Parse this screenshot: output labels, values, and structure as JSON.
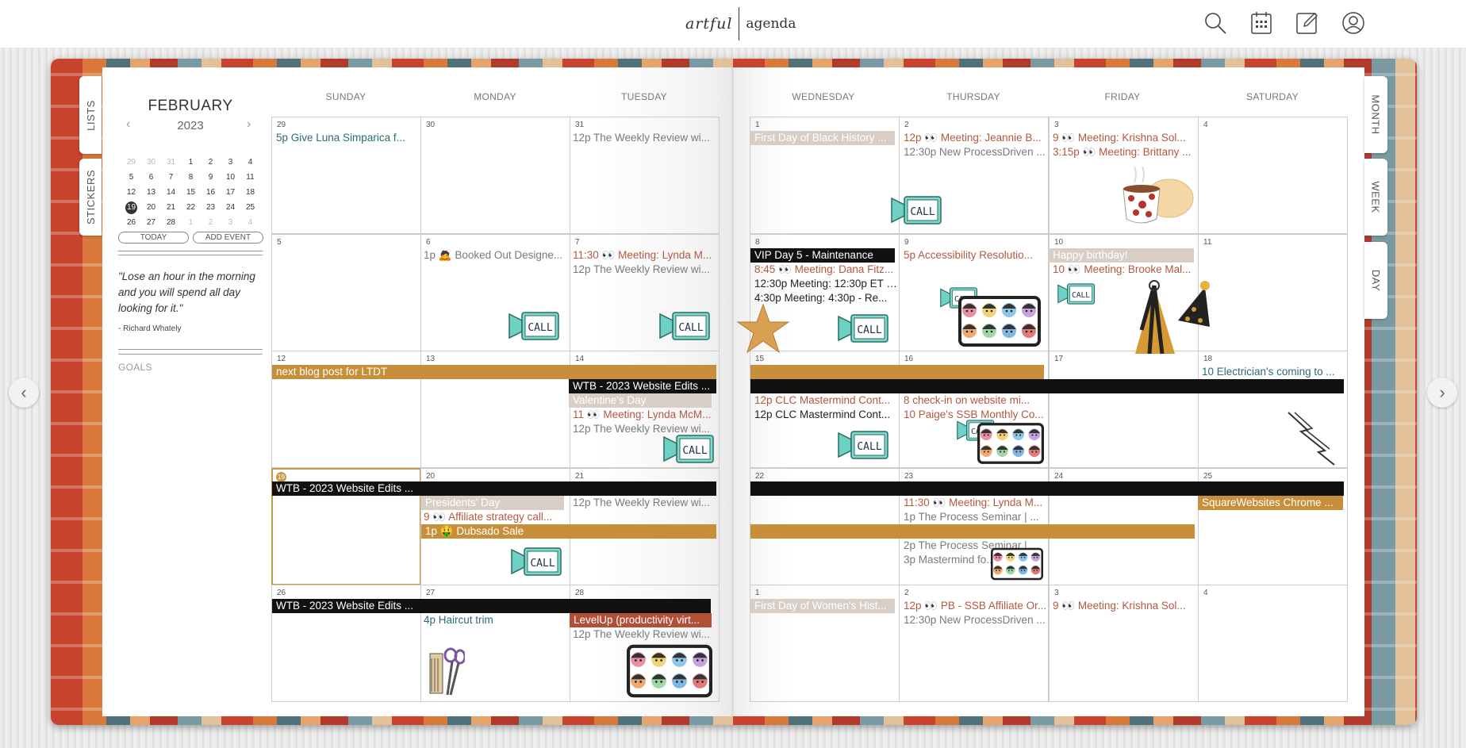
{
  "header": {
    "logo_left": "artful",
    "logo_right": "agenda",
    "icons": [
      "search-icon",
      "calendar-icon",
      "edit-icon",
      "user-icon"
    ]
  },
  "tabs": {
    "left": [
      "LISTS",
      "STICKERS"
    ],
    "right": [
      "MONTH",
      "WEEK",
      "DAY"
    ]
  },
  "sidebar": {
    "month": "FEBRUARY",
    "year": "2023",
    "prev_icon": "‹",
    "next_icon": "›",
    "mini_days": [
      [
        "29",
        "30",
        "31",
        "1",
        "2",
        "3",
        "4"
      ],
      [
        "5",
        "6",
        "7",
        "8",
        "9",
        "10",
        "11"
      ],
      [
        "12",
        "13",
        "14",
        "15",
        "16",
        "17",
        "18"
      ],
      [
        "19",
        "20",
        "21",
        "22",
        "23",
        "24",
        "25"
      ],
      [
        "26",
        "27",
        "28",
        "1",
        "2",
        "3",
        "4"
      ]
    ],
    "today_button": "TODAY",
    "add_event_button": "ADD EVENT",
    "quote": "\"Lose an hour in the morning and you will spend all day looking for it.\"",
    "author": "- Richard Whately",
    "goals": "GOALS"
  },
  "weekdays": [
    "SUNDAY",
    "MONDAY",
    "TUESDAY",
    "WEDNESDAY",
    "THURSDAY",
    "FRIDAY",
    "SATURDAY"
  ],
  "days": [
    [
      "29",
      "30",
      "31",
      "1",
      "2",
      "3",
      "4"
    ],
    [
      "5",
      "6",
      "7",
      "8",
      "9",
      "10",
      "11"
    ],
    [
      "12",
      "13",
      "14",
      "15",
      "16",
      "17",
      "18"
    ],
    [
      "19",
      "20",
      "21",
      "22",
      "23",
      "24",
      "25"
    ],
    [
      "26",
      "27",
      "28",
      "1",
      "2",
      "3",
      "4"
    ]
  ],
  "events": {
    "w1": {
      "sun": "5p Give Luna Simparica f...",
      "tue": "12p The Weekly Review wi...",
      "wed": "First Day of Black History ...",
      "thu1": "12p 👀 Meeting: Jeannie B...",
      "thu2": "12:30p New ProcessDriven ...",
      "fri1": "9 👀 Meeting: Krishna Sol...",
      "fri2": "3:15p 👀 Meeting: Brittany ..."
    },
    "w2": {
      "mon": "1p 🙇 Booked Out Designe...",
      "tue1": "11:30 👀 Meeting: Lynda M...",
      "tue2": "12p The Weekly Review wi...",
      "wed_bar": "VIP Day 5 - Maintenance",
      "wed1": "8:45 👀 Meeting: Dana Fitz...",
      "wed2": "12:30p Meeting: 12:30p ET -...",
      "wed3": "4:30p Meeting: 4:30p - Re...",
      "thu": "5p Accessibility Resolutio...",
      "fri_bar": "Happy birthday!",
      "fri": "10 👀 Meeting: Brooke Mal..."
    },
    "w3": {
      "blog_bar": "next blog post for LTDT",
      "wtb_bar": "WTB - 2023 Website Edits ...",
      "valentine": "Valentine's Day",
      "tue1": "11 👀 Meeting: Lynda McM...",
      "tue2": "12p The Weekly Review wi...",
      "wed1": "12p CLC Mastermind Cont...",
      "wed2": "12p CLC Mastermind Cont...",
      "thu1": "8 check-in on website mi...",
      "thu2": "10 Paige's SSB Monthly Co...",
      "sat": "10 Electrician's coming to ..."
    },
    "w4": {
      "wtb_bar": "WTB - 2023 Website Edits ...",
      "presidents": "Presidents' Day",
      "mon": "9 👀 Affiliate strategy call...",
      "dubsado": "1p 🤑 Dubsado Sale",
      "tue": "12p The Weekly Review wi...",
      "thu1": "11:30 👀 Meeting: Lynda M...",
      "thu2": "1p The Process Seminar | ...",
      "thu3": "2p The Process Seminar | ...",
      "thu4": "3p Mastermind fo...",
      "sat_bar": "SquareWebsites Chrome ..."
    },
    "w5": {
      "wtb_bar": "WTB - 2023 Website Edits ...",
      "mon": "4p Haircut trim",
      "levelup": "LevelUp (productivity virt...",
      "tue": "12p The Weekly Review wi...",
      "wed": "First Day of Women's Hist...",
      "thu1": "12p 👀 PB - SSB Affiliate Or...",
      "thu2": "12:30p New ProcessDriven ...",
      "fri": "9 👀 Meeting: Krishna Sol..."
    }
  },
  "stickers": {
    "call_label": "CALL",
    "items": [
      "call-sticker",
      "tea-cup-sticker",
      "star-sticker",
      "party-hat-sticker",
      "video-call-sticker",
      "lightning-sticker",
      "scissors-comb-sticker"
    ]
  },
  "colors": {
    "accent_gold": "#c88f3b",
    "teal_text": "#2b6c75",
    "orange_text": "#b4583f",
    "event_black": "#111111",
    "holiday_pill": "#d8cec6"
  }
}
